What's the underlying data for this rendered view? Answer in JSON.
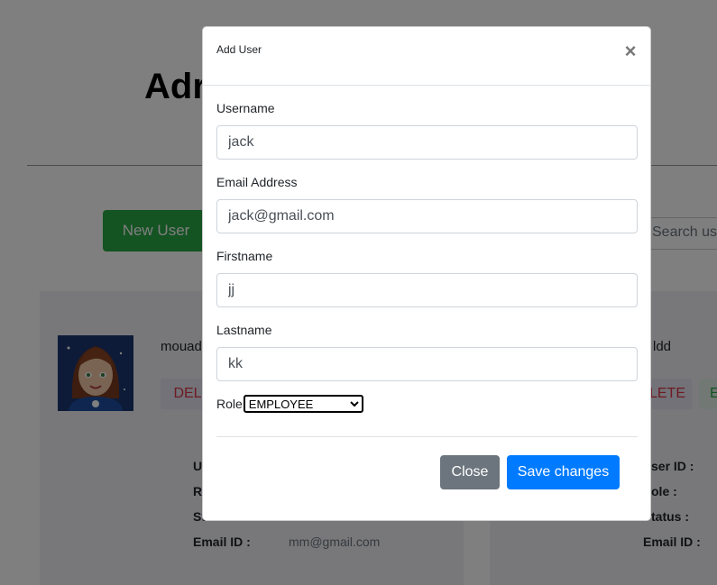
{
  "page": {
    "title": "Adr",
    "new_user_button": "New User",
    "search_placeholder": "Search use"
  },
  "cards": [
    {
      "name": "mouad",
      "delete_label": "DEL",
      "labels": [
        "U",
        "Ro",
        "St",
        "Email ID :"
      ],
      "email": "mm@gmail.com"
    },
    {
      "name": "ldd",
      "delete_label": "LETE",
      "edit_label": "E",
      "labels": [
        "ser ID :",
        "ole :",
        "tatus :",
        "Email ID :"
      ]
    }
  ],
  "modal": {
    "title": "Add User",
    "close_icon": "×",
    "fields": [
      {
        "label": "Username",
        "value": "jack"
      },
      {
        "label": "Email Address",
        "value": "jack@gmail.com"
      },
      {
        "label": "Firstname",
        "value": "jj"
      },
      {
        "label": "Lastname",
        "value": "kk"
      }
    ],
    "role": {
      "label": "Role",
      "selected": "EMPLOYEE"
    },
    "close_button": "Close",
    "save_button": "Save changes"
  }
}
